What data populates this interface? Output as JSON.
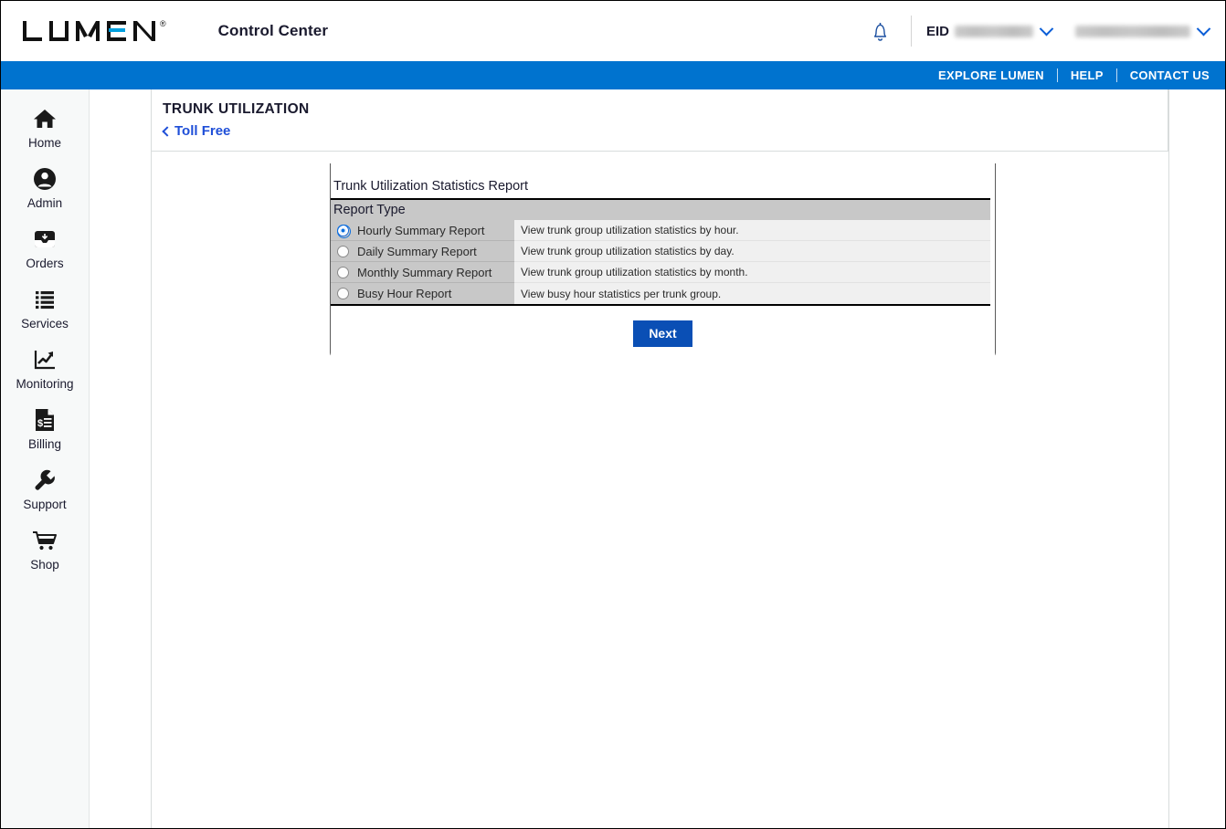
{
  "header": {
    "logo_text": "LUMEN",
    "logo_registered": "®",
    "app_title": "Control Center",
    "bell_icon": "notification-bell-icon",
    "eid_label": "EID",
    "eid_value": "",
    "user_value": "",
    "eid_caret_icon": "chevron-down-icon",
    "user_caret_icon": "chevron-down-icon"
  },
  "bluebar": {
    "links": [
      {
        "label": "EXPLORE LUMEN"
      },
      {
        "label": "HELP"
      },
      {
        "label": "CONTACT US"
      }
    ]
  },
  "sidebar": {
    "items": [
      {
        "label": "Home",
        "icon": "home-icon"
      },
      {
        "label": "Admin",
        "icon": "user-circle-icon"
      },
      {
        "label": "Orders",
        "icon": "inbox-tray-icon"
      },
      {
        "label": "Services",
        "icon": "list-icon"
      },
      {
        "label": "Monitoring",
        "icon": "chart-trend-icon"
      },
      {
        "label": "Billing",
        "icon": "invoice-dollar-icon"
      },
      {
        "label": "Support",
        "icon": "wrench-icon"
      },
      {
        "label": "Shop",
        "icon": "shopping-cart-icon"
      }
    ]
  },
  "page": {
    "title": "TRUNK UTILIZATION",
    "back_link": "Toll Free",
    "back_icon": "chevron-left-icon"
  },
  "panel": {
    "title": "Trunk Utilization Statistics Report",
    "column_header": "Report Type",
    "options": [
      {
        "label": "Hourly Summary Report",
        "description": "View trunk group utilization statistics by hour.",
        "selected": true
      },
      {
        "label": "Daily Summary Report",
        "description": "View trunk group utilization statistics by day.",
        "selected": false
      },
      {
        "label": "Monthly Summary Report",
        "description": "View trunk group utilization statistics by month.",
        "selected": false
      },
      {
        "label": "Busy Hour Report",
        "description": "View busy hour statistics per trunk group.",
        "selected": false
      }
    ],
    "next_label": "Next"
  },
  "colors": {
    "brand_blue": "#0073cf",
    "link_blue": "#1f4fd8",
    "button_blue": "#0a4fb5",
    "header_gray": "#c8c8c8",
    "desc_gray": "#f0f0f0",
    "sidebar_bg": "#f7f9f9"
  }
}
